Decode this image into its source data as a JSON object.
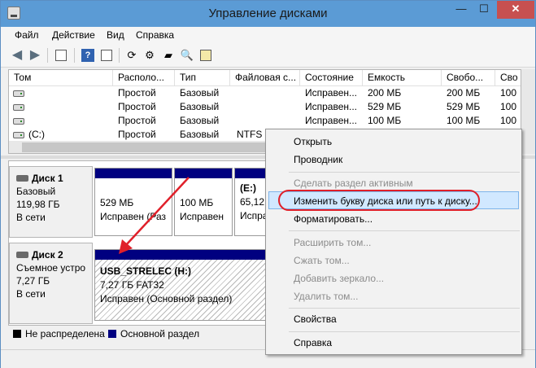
{
  "window": {
    "title": "Управление дисками",
    "controls": {
      "minimize": "—",
      "maximize": "☐",
      "close": "✕"
    }
  },
  "menu": [
    "Файл",
    "Действие",
    "Вид",
    "Справка"
  ],
  "volumes": {
    "columns": [
      "Том",
      "Располо...",
      "Тип",
      "Файловая с...",
      "Состояние",
      "Емкость",
      "Свобо...",
      "Сво"
    ],
    "rows": [
      {
        "name": "",
        "layout": "Простой",
        "type": "Базовый",
        "fs": "",
        "status": "Исправен...",
        "capacity": "200 МБ",
        "free": "200 МБ",
        "pct": "100"
      },
      {
        "name": "",
        "layout": "Простой",
        "type": "Базовый",
        "fs": "",
        "status": "Исправен...",
        "capacity": "529 МБ",
        "free": "529 МБ",
        "pct": "100"
      },
      {
        "name": "",
        "layout": "Простой",
        "type": "Базовый",
        "fs": "",
        "status": "Исправен...",
        "capacity": "100 МБ",
        "free": "100 МБ",
        "pct": "100"
      },
      {
        "name": "(C:)",
        "layout": "Простой",
        "type": "Базовый",
        "fs": "NTFS",
        "status": "",
        "capacity": "",
        "free": "",
        "pct": ""
      }
    ]
  },
  "disks": [
    {
      "name": "Диск 1",
      "kind": "Базовый",
      "size": "119,98 ГБ",
      "state": "В сети",
      "partitions": [
        {
          "size": "529 МБ",
          "status": "Исправен (Раз"
        },
        {
          "size": "100 МБ",
          "status": "Исправен"
        },
        {
          "label": "(E:)",
          "size": "65,12 Г",
          "status": "Исправ"
        }
      ]
    },
    {
      "name": "Диск 2",
      "kind": "Съемное устро",
      "size": "7,27 ГБ",
      "state": "В сети",
      "partition": {
        "label": "USB_STRELEC  (H:)",
        "size": "7,27 ГБ FAT32",
        "status": "Исправен (Основной раздел)"
      }
    }
  ],
  "legend": {
    "unallocated": "Не распределена",
    "primary": "Основной раздел",
    "unallocated_color": "#000000",
    "primary_color": "#000080"
  },
  "context_menu": {
    "items": [
      {
        "label": "Открыть",
        "enabled": true
      },
      {
        "label": "Проводник",
        "enabled": true
      },
      {
        "label": "Сделать раздел активным",
        "enabled": false
      },
      {
        "label": "Изменить букву диска или путь к диску...",
        "enabled": true,
        "highlighted": true
      },
      {
        "label": "Форматировать...",
        "enabled": true
      },
      {
        "label": "Расширить том...",
        "enabled": false
      },
      {
        "label": "Сжать том...",
        "enabled": false
      },
      {
        "label": "Добавить зеркало...",
        "enabled": false
      },
      {
        "label": "Удалить том...",
        "enabled": false
      },
      {
        "label": "Свойства",
        "enabled": true
      },
      {
        "label": "Справка",
        "enabled": true
      }
    ]
  },
  "annotation": {
    "color": "#e0202a"
  }
}
